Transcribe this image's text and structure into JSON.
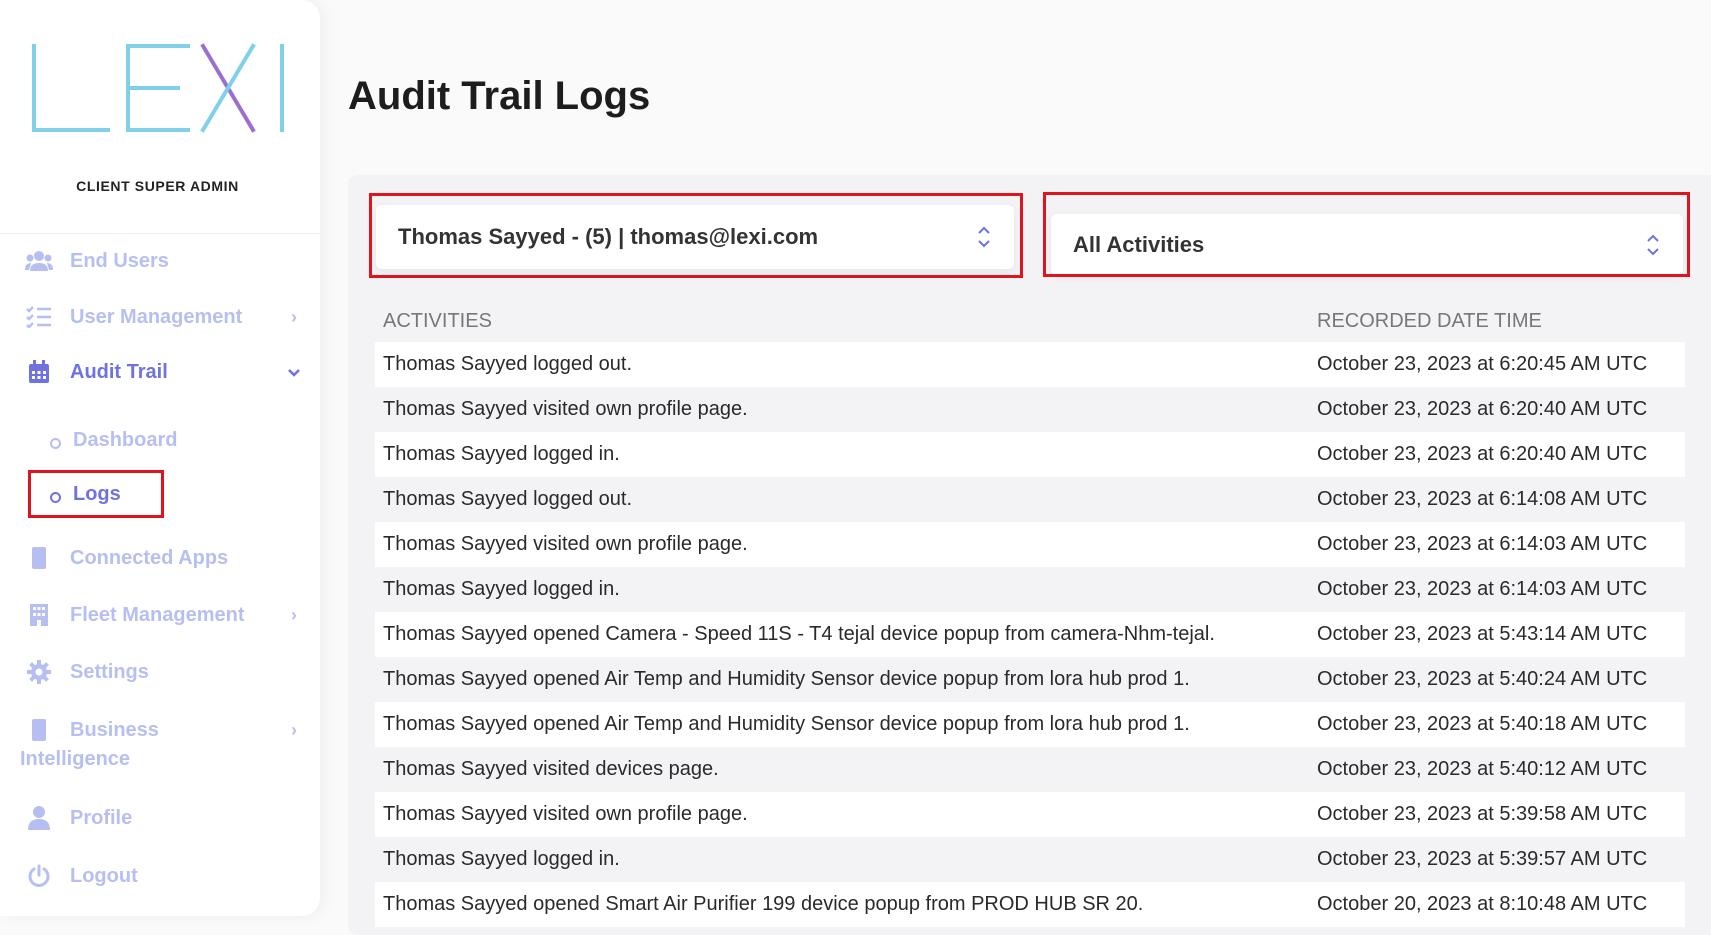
{
  "brand": {
    "logo_text": "LEXI",
    "role": "CLIENT SUPER ADMIN"
  },
  "sidebar": {
    "items": [
      {
        "label": "End Users",
        "icon": "users-icon"
      },
      {
        "label": "User Management",
        "icon": "list-check-icon"
      },
      {
        "label": "Audit Trail",
        "icon": "calendar-icon"
      },
      {
        "label": "Connected Apps",
        "icon": "mobile-icon"
      },
      {
        "label": "Fleet Management",
        "icon": "building-icon"
      },
      {
        "label": "Settings",
        "icon": "gear-icon"
      },
      {
        "label": "Business",
        "label_line2": "Intelligence",
        "icon": "mobile-icon"
      },
      {
        "label": "Profile",
        "icon": "user-icon"
      },
      {
        "label": "Logout",
        "icon": "power-icon"
      }
    ],
    "audit_sub": [
      {
        "label": "Dashboard"
      },
      {
        "label": "Logs"
      }
    ]
  },
  "page": {
    "title": "Audit Trail Logs"
  },
  "filters": {
    "user_select": "Thomas Sayyed - (5) | thomas@lexi.com",
    "activity_select": "All Activities"
  },
  "table": {
    "headers": [
      "ACTIVITIES",
      "RECORDED DATE TIME"
    ],
    "rows": [
      [
        "Thomas Sayyed logged out.",
        "October 23, 2023 at 6:20:45 AM UTC"
      ],
      [
        "Thomas Sayyed visited own profile page.",
        "October 23, 2023 at 6:20:40 AM UTC"
      ],
      [
        "Thomas Sayyed logged in.",
        "October 23, 2023 at 6:20:40 AM UTC"
      ],
      [
        "Thomas Sayyed logged out.",
        "October 23, 2023 at 6:14:08 AM UTC"
      ],
      [
        "Thomas Sayyed visited own profile page.",
        "October 23, 2023 at 6:14:03 AM UTC"
      ],
      [
        "Thomas Sayyed logged in.",
        "October 23, 2023 at 6:14:03 AM UTC"
      ],
      [
        "Thomas Sayyed opened Camera - Speed 11S - T4 tejal device popup from camera-Nhm-tejal.",
        "October 23, 2023 at 5:43:14 AM UTC"
      ],
      [
        "Thomas Sayyed opened Air Temp and Humidity Sensor device popup from lora hub prod 1.",
        "October 23, 2023 at 5:40:24 AM UTC"
      ],
      [
        "Thomas Sayyed opened Air Temp and Humidity Sensor device popup from lora hub prod 1.",
        "October 23, 2023 at 5:40:18 AM UTC"
      ],
      [
        "Thomas Sayyed visited devices page.",
        "October 23, 2023 at 5:40:12 AM UTC"
      ],
      [
        "Thomas Sayyed visited own profile page.",
        "October 23, 2023 at 5:39:58 AM UTC"
      ],
      [
        "Thomas Sayyed logged in.",
        "October 23, 2023 at 5:39:57 AM UTC"
      ],
      [
        "Thomas Sayyed opened Smart Air Purifier 199 device popup from PROD HUB SR 20.",
        "October 20, 2023 at 8:10:48 AM UTC"
      ]
    ]
  },
  "colors": {
    "accent": "#6f72e0",
    "nav_inactive": "#b7bff2",
    "highlight": "#e0141e",
    "logo_blue": "#7fd0e8",
    "logo_purple": "#9b6fd0"
  }
}
